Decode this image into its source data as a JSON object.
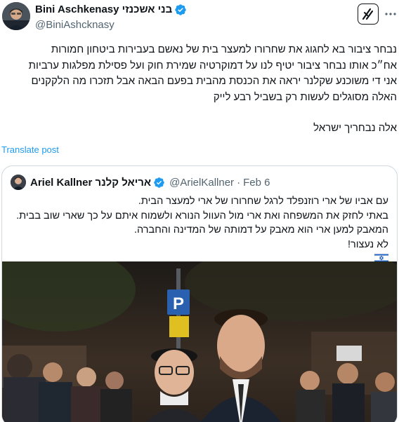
{
  "author": {
    "display_name": "Bini Aschkenasy בני אשכנזי",
    "handle": "@BiniAshcknasy"
  },
  "icons": {
    "verified": "verified-badge-icon",
    "grok": "grok-icon",
    "more": "more-options-icon",
    "flag": "israel-flag-icon"
  },
  "post": {
    "lines": [
      "נבחר ציבור בא לחגוג את שחרורו למעצר בית של נאשם בעבירות ביטחון חמורות",
      "אח״כ אותו נבחר ציבור יטיף לנו על דמוקרטיה שמירת חוק ועל פסילת מפלגות ערביות",
      "אני די משוכנע שקלנר יראה את הכנסת מהבית בפעם הבאה אבל תזכרו מה הלקקנים",
      "האלה מסוגלים לעשות רק בשביל רבע לייק",
      "אלה נבחריך ישראל"
    ],
    "translate_label": "Translate post"
  },
  "quote": {
    "display_name": "Ariel Kallner אריאל קלנר",
    "handle": "@ArielKallner",
    "separator": "·",
    "date": "Feb 6",
    "lines": [
      "עם אביו של ארי רוזנפלד לרגל שחרורו של ארי למעצר הבית.",
      "באתי לחזק את המשפחה ואת ארי מול העוול הנורא ולשמוח איתם על כך שארי שוב בבית.",
      "המאבק למען ארי הוא מאבק על דמותה של המדינה והחברה.",
      "לא נעצור!"
    ],
    "media_sign": "P"
  },
  "colors": {
    "text": "#0f1419",
    "secondary": "#536471",
    "link": "#1d9bf0",
    "border": "#cfd9de",
    "verified": "#1d9bf0"
  }
}
